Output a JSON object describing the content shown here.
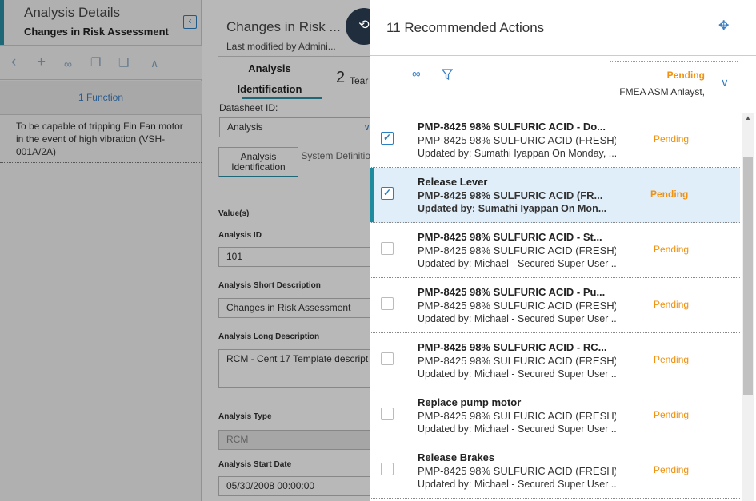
{
  "left": {
    "title": "Analysis Details",
    "subtitle": "Changes in Risk Assessment",
    "function_tab": "1 Function",
    "function_description": "To be capable of tripping Fin Fan motor in the event of high vibration (VSH-001A/2A)"
  },
  "mid": {
    "title": "Changes in Risk ...",
    "modified": "Last modified by Admini...",
    "tab_analysis_line1": "Analysis",
    "tab_analysis_line2": "Identification",
    "team_count": "2",
    "team_label": "Tear",
    "datasheet_label": "Datasheet ID:",
    "datasheet_value": "Analysis",
    "subtab_active": "Analysis Identification",
    "subtab_inactive": "System Definition",
    "values_label": "Value(s)",
    "fields": [
      {
        "label": "Analysis ID",
        "value": "101"
      },
      {
        "label": "Analysis Short Description",
        "value": "Changes in Risk Assessment"
      },
      {
        "label": "Analysis Long Description",
        "value": "RCM - Cent 17 Template descript"
      },
      {
        "label": "Analysis Type",
        "value": "RCM"
      },
      {
        "label": "Analysis Start Date",
        "value": "05/30/2008 00:00:00"
      }
    ]
  },
  "drawer": {
    "title": "11 Recommended Actions",
    "status_filter": "Pending",
    "team_filter": "FMEA ASM Anlayst,",
    "rows": [
      {
        "title": "PMP-8425 98% SULFURIC ACID - Do...",
        "line2": "PMP-8425 98% SULFURIC ACID (FRESH)",
        "line3": "Updated by: Sumathi Iyappan On  Monday, ...",
        "status": "Pending",
        "checked": true,
        "selected": false
      },
      {
        "title": "Release Lever",
        "line2": "PMP-8425 98% SULFURIC ACID (FR...",
        "line3": "Updated by: Sumathi Iyappan On  Mon...",
        "status": "Pending",
        "checked": true,
        "selected": true
      },
      {
        "title": "PMP-8425 98% SULFURIC ACID - St...",
        "line2": "PMP-8425 98% SULFURIC ACID (FRESH)",
        "line3": "Updated by: Michael - Secured Super User ...",
        "status": "Pending",
        "checked": false,
        "selected": false
      },
      {
        "title": "PMP-8425 98% SULFURIC ACID - Pu...",
        "line2": "PMP-8425 98% SULFURIC ACID (FRESH)",
        "line3": "Updated by: Michael - Secured Super User ...",
        "status": "Pending",
        "checked": false,
        "selected": false
      },
      {
        "title": "PMP-8425 98% SULFURIC ACID - RC...",
        "line2": "PMP-8425 98% SULFURIC ACID (FRESH)",
        "line3": "Updated by: Michael - Secured Super User ...",
        "status": "Pending",
        "checked": false,
        "selected": false
      },
      {
        "title": "Replace pump motor",
        "line2": "PMP-8425 98% SULFURIC ACID (FRESH)",
        "line3": "Updated by: Michael - Secured Super User ...",
        "status": "Pending",
        "checked": false,
        "selected": false
      },
      {
        "title": "Release Brakes",
        "line2": "PMP-8425 98% SULFURIC ACID (FRESH)",
        "line3": "Updated by: Michael - Secured Super User ...",
        "status": "Pending",
        "checked": false,
        "selected": false
      }
    ]
  },
  "colors": {
    "accent": "#2a8fa5",
    "link": "#3a7fc4",
    "pending": "#f0910f",
    "selected_row": "#e0eefa",
    "back_button": "#1f2d3d"
  }
}
